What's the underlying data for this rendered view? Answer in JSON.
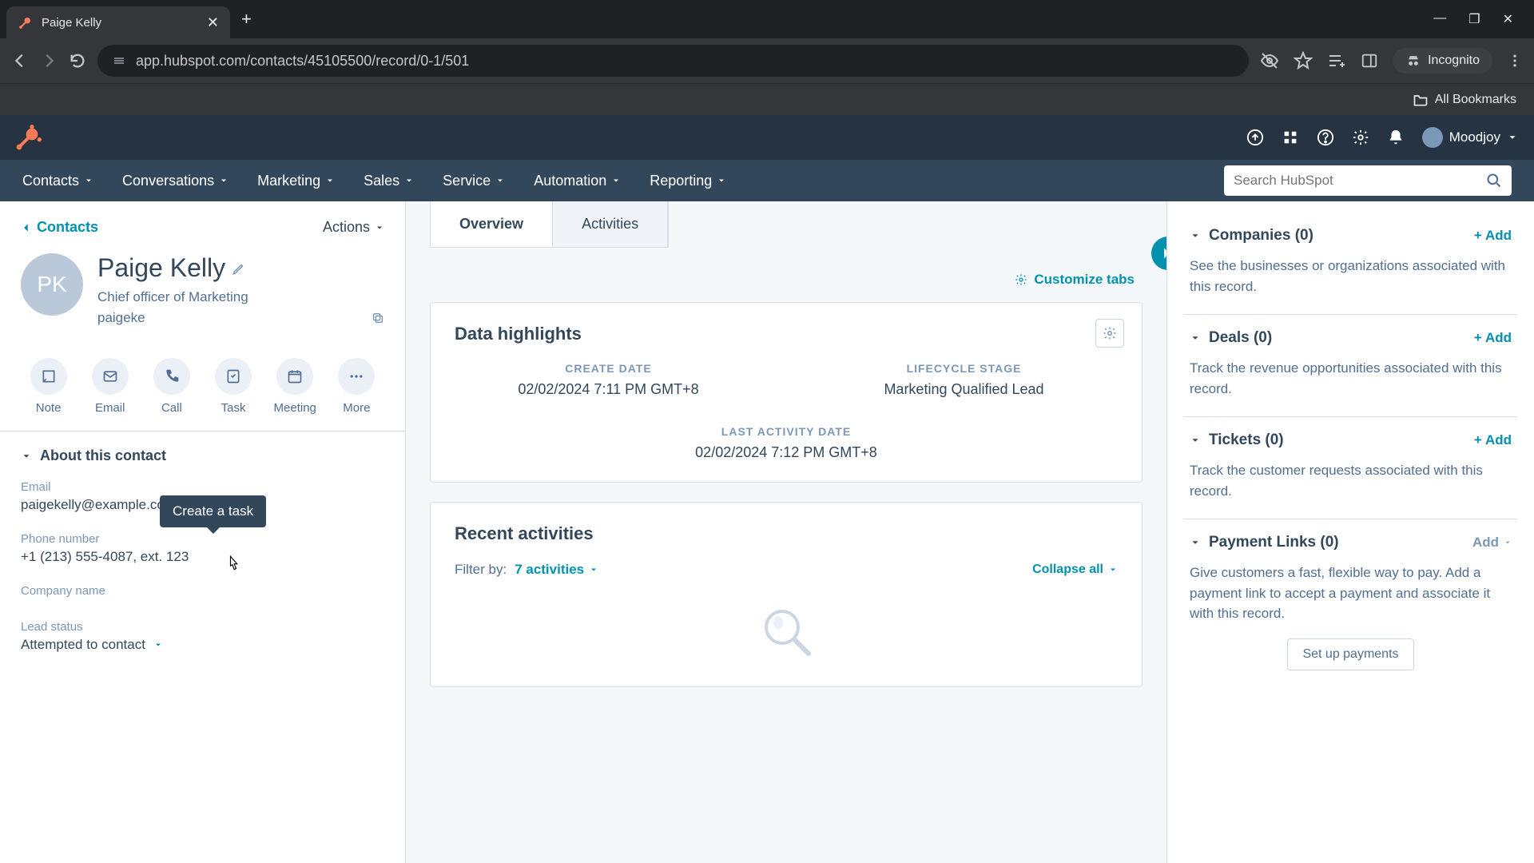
{
  "browser": {
    "tab_title": "Paige Kelly",
    "url": "app.hubspot.com/contacts/45105500/record/0-1/501",
    "incognito_label": "Incognito",
    "bookmarks_label": "All Bookmarks"
  },
  "top_right": {
    "account_name": "Moodjoy"
  },
  "nav": {
    "items": [
      "Contacts",
      "Conversations",
      "Marketing",
      "Sales",
      "Service",
      "Automation",
      "Reporting"
    ],
    "search_placeholder": "Search HubSpot"
  },
  "left": {
    "back_label": "Contacts",
    "actions_label": "Actions",
    "avatar_initials": "PK",
    "contact_name": "Paige Kelly",
    "contact_title": "Chief officer of Marketing",
    "contact_email_short": "paigeke",
    "tooltip_text": "Create a task",
    "actions": [
      {
        "label": "Note",
        "name": "note"
      },
      {
        "label": "Email",
        "name": "email"
      },
      {
        "label": "Call",
        "name": "call"
      },
      {
        "label": "Task",
        "name": "task"
      },
      {
        "label": "Meeting",
        "name": "meeting"
      },
      {
        "label": "More",
        "name": "more"
      }
    ],
    "about_header": "About this contact",
    "fields": {
      "email_label": "Email",
      "email_value": "paigekelly@example.com",
      "phone_label": "Phone number",
      "phone_value": "+1 (213) 555-4087, ext. 123",
      "company_label": "Company name",
      "company_value": "",
      "lead_label": "Lead status",
      "lead_value": "Attempted to contact"
    }
  },
  "mid": {
    "tabs": {
      "overview": "Overview",
      "activities": "Activities"
    },
    "customize_label": "Customize tabs",
    "highlights_title": "Data highlights",
    "highlights": [
      {
        "label": "CREATE DATE",
        "value": "02/02/2024 7:11 PM GMT+8"
      },
      {
        "label": "LIFECYCLE STAGE",
        "value": "Marketing Qualified Lead"
      },
      {
        "label": "LAST ACTIVITY DATE",
        "value": "02/02/2024 7:12 PM GMT+8"
      }
    ],
    "recent_title": "Recent activities",
    "filter_by_label": "Filter by:",
    "filter_value": "7 activities",
    "collapse_label": "Collapse all"
  },
  "right": {
    "cards": [
      {
        "title": "Companies (0)",
        "add": "+ Add",
        "body": "See the businesses or organizations associated with this record."
      },
      {
        "title": "Deals (0)",
        "add": "+ Add",
        "body": "Track the revenue opportunities associated with this record."
      },
      {
        "title": "Tickets (0)",
        "add": "+ Add",
        "body": "Track the customer requests associated with this record."
      },
      {
        "title": "Payment Links (0)",
        "add": "Add",
        "body": "Give customers a fast, flexible way to pay. Add a payment link to accept a payment and associate it with this record.",
        "button": "Set up payments"
      }
    ]
  }
}
